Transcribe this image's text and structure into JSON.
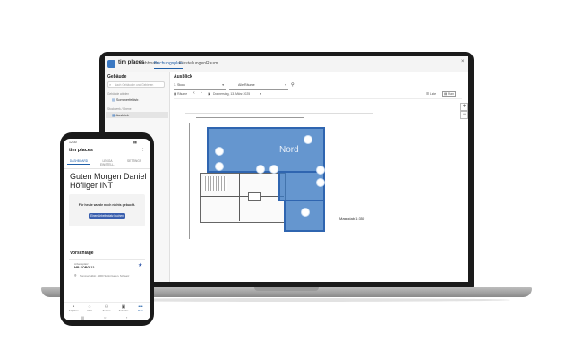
{
  "app": {
    "brand": "tim places",
    "nav": [
      "Dashboard",
      "Buchungsplan",
      "Einstellungen",
      "Raum"
    ]
  },
  "sidebar": {
    "title": "Gebäude",
    "search_placeholder": "Nach Gebäuden und Gebieten",
    "label_building": "Gebäude wählen",
    "item_building": "Sommerfeldstr.",
    "label_floor": "Stockwerk / Ebene",
    "item_floor": "Ausblick"
  },
  "main": {
    "title": "Ausblick",
    "floor_select": "1. Stock",
    "room_select": "Alle Räume",
    "tb_rooms": "Räume",
    "tb_date": "Donnerstag, 13. März 2025",
    "tb_list": "Liste",
    "tb_plan": "Plan"
  },
  "floorplan": {
    "room_label": "Nord",
    "scale": "Massstab 1:350"
  },
  "phone": {
    "status_time": "12:30",
    "title": "tim places",
    "tabs": [
      "DASHBOARD",
      "LEGGA EINSTELL.",
      "SETTINGS"
    ],
    "greeting": "Guten Morgen Daniel Höfliger INT",
    "card_text": "Für heute wurde noch nichts gebucht.",
    "card_button": "Einen Arbeitsplatz buchen",
    "section": "Vorschläge",
    "suggestion": {
      "category": "Arbeitsplatz",
      "title": "MP-SORG-12",
      "address": "Sommerfeldstr., 9000 Sankt Gallen, Schweiz"
    },
    "bottom_nav": [
      "Aufgaben",
      "Chat",
      "Suchen",
      "Kalender",
      "Mehr"
    ]
  }
}
